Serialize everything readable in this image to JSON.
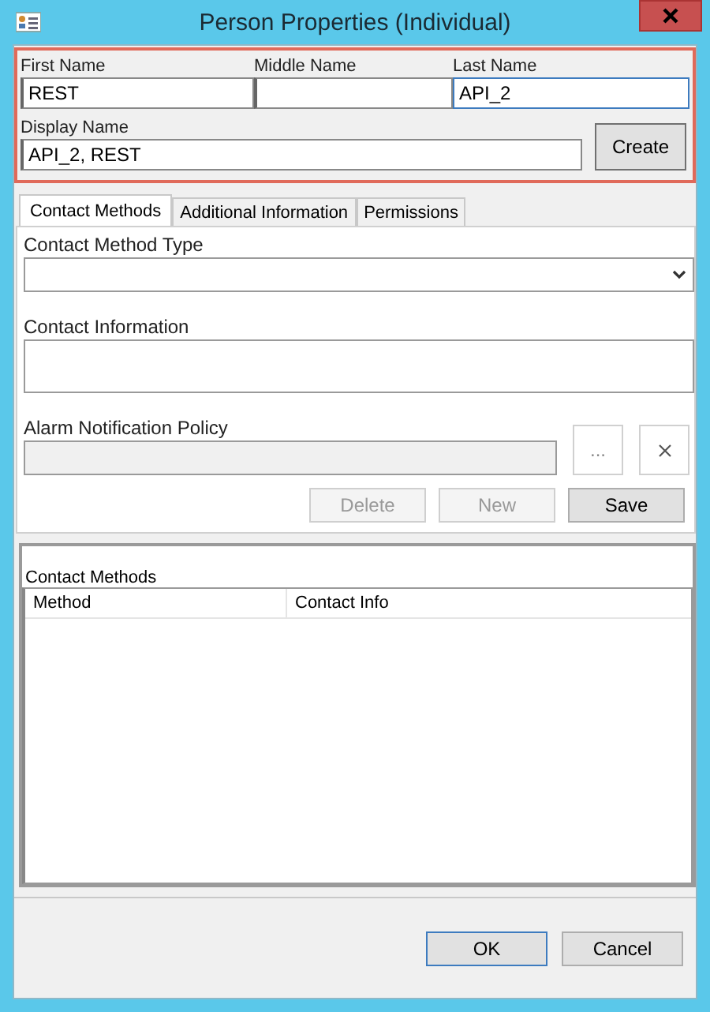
{
  "window": {
    "title": "Person Properties (Individual)"
  },
  "name_fields": [
    {
      "label": "First Name",
      "value": "REST",
      "focused": false
    },
    {
      "label": "Middle Name",
      "focused": false
    },
    {
      "label": "Last Name",
      "value": "API_2",
      "focused": true
    }
  ],
  "display_name": {
    "label": "Display Name",
    "value": "API_2, REST"
  },
  "create_button": {
    "label": "Create"
  },
  "tabs": [
    {
      "label": "Contact Methods",
      "selected": true
    },
    {
      "label": "Additional Information",
      "selected": false
    },
    {
      "label": "Permissions",
      "selected": false
    }
  ],
  "contact_method_type": {
    "label": "Contact Method Type"
  },
  "contact_information": {
    "label": "Contact Information"
  },
  "alarm_notification_policy": {
    "label": "Alarm Notification Policy",
    "disabled": true,
    "browse_label": "..."
  },
  "action_buttons": [
    {
      "label": "Delete",
      "disabled": true
    },
    {
      "label": "New",
      "disabled": true
    },
    {
      "label": "Save",
      "disabled": false
    }
  ],
  "contact_methods_list": {
    "title": "Contact Methods",
    "columns": [
      "Method",
      "Contact Info"
    ]
  },
  "dialog_buttons": [
    {
      "label": "OK",
      "default": true
    },
    {
      "label": "Cancel",
      "default": false
    }
  ]
}
